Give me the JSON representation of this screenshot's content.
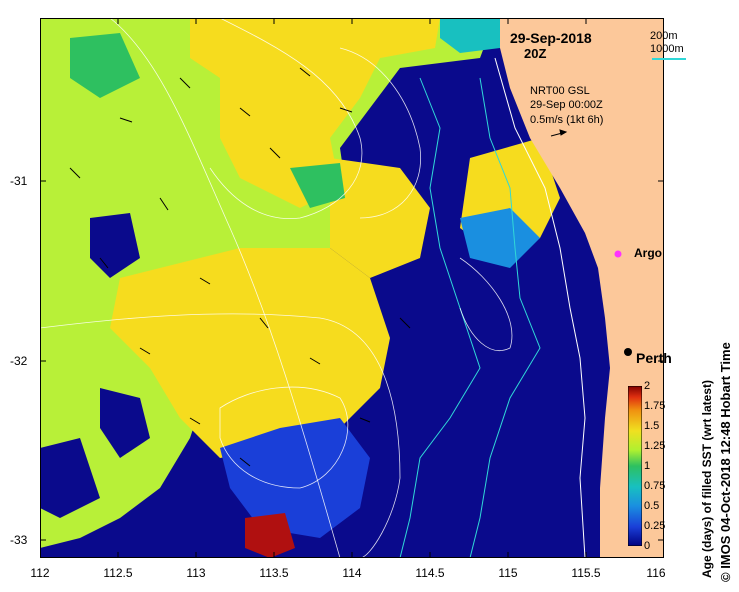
{
  "header": {
    "date": "29-Sep-2018",
    "time": "20Z"
  },
  "isobath_legend": {
    "label_200": "200m",
    "label_1000": "1000m",
    "color_200": "#ffffff",
    "color_1000": "#30d8d8"
  },
  "current_legend": {
    "line1": "NRT00 GSL",
    "line2": "29-Sep 00:00Z",
    "line3": "0.5m/s (1kt 6h)"
  },
  "markers": {
    "argo": {
      "label": "Argo",
      "lon": 115.75,
      "lat": -31.4,
      "color": "#ff33ff"
    },
    "perth": {
      "label": "Perth",
      "lon": 115.86,
      "lat": -31.95
    }
  },
  "axes": {
    "x_ticks": [
      "112",
      "112.5",
      "113",
      "113.5",
      "114",
      "114.5",
      "115",
      "115.5",
      "116"
    ],
    "y_ticks": [
      "-31",
      "-32",
      "-33"
    ],
    "xlim": [
      112,
      116.05
    ],
    "ylim": [
      -33.1,
      -30.1
    ]
  },
  "colorbar": {
    "title": "Age (days) of filled SST (wrt latest)",
    "ticks": [
      "0",
      "0.25",
      "0.5",
      "0.75",
      "1",
      "1.25",
      "1.5",
      "1.75",
      "2"
    ],
    "range": [
      0,
      2
    ],
    "colors": [
      "#000080",
      "#1a3fd8",
      "#1a8fe0",
      "#18c0c0",
      "#2ec060",
      "#b0f030",
      "#f0e020",
      "#f09010",
      "#e03010",
      "#800000"
    ]
  },
  "credit": "© IMOS 04-Oct-2018 12:48 Hobart Time",
  "colors": {
    "land": "#fcc89a",
    "sst_young": "#0a0a8c",
    "sst_mid": "#b8f038",
    "sst_old": "#f6dc1e"
  }
}
